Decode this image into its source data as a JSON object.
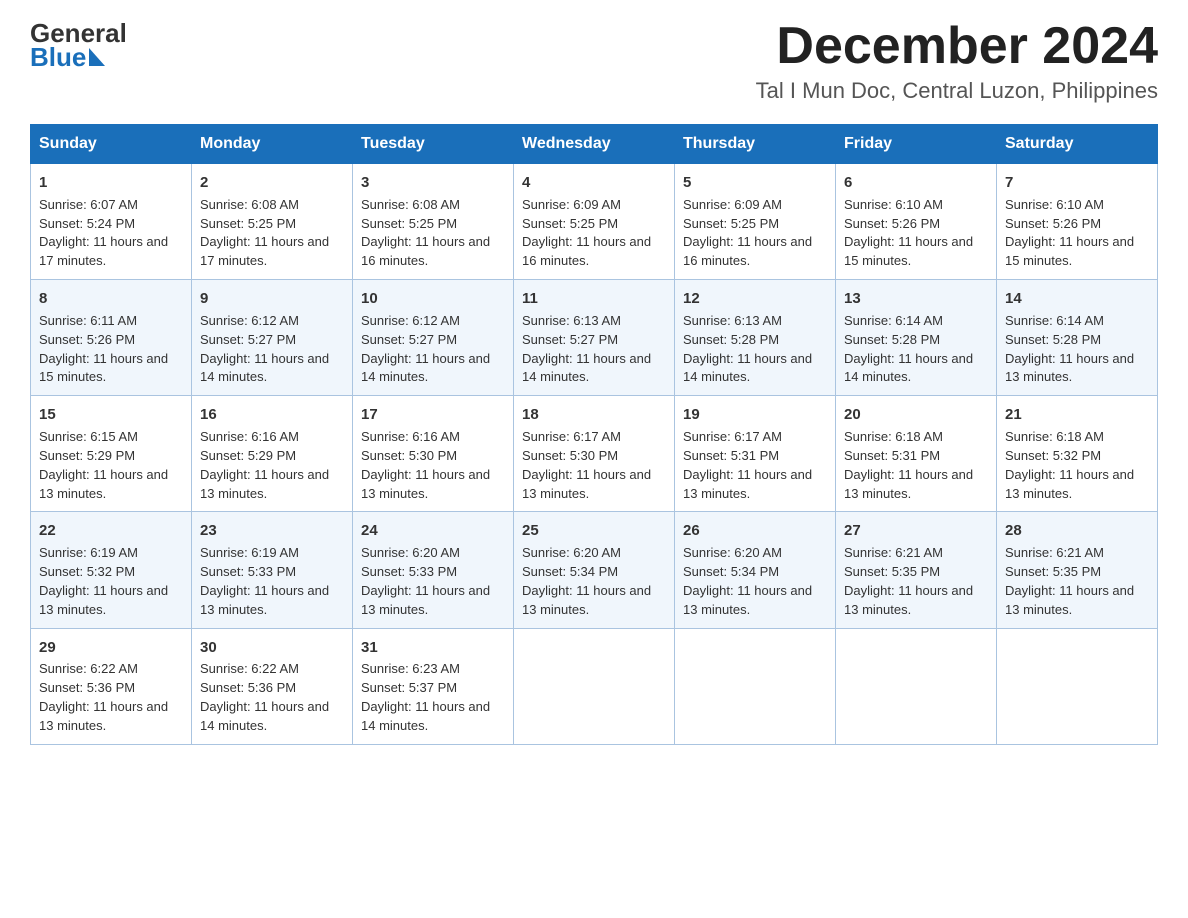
{
  "header": {
    "logo_general": "General",
    "logo_blue": "Blue",
    "month_title": "December 2024",
    "location": "Tal I Mun Doc, Central Luzon, Philippines"
  },
  "days_of_week": [
    "Sunday",
    "Monday",
    "Tuesday",
    "Wednesday",
    "Thursday",
    "Friday",
    "Saturday"
  ],
  "weeks": [
    [
      {
        "day": "1",
        "sunrise": "6:07 AM",
        "sunset": "5:24 PM",
        "daylight": "11 hours and 17 minutes."
      },
      {
        "day": "2",
        "sunrise": "6:08 AM",
        "sunset": "5:25 PM",
        "daylight": "11 hours and 17 minutes."
      },
      {
        "day": "3",
        "sunrise": "6:08 AM",
        "sunset": "5:25 PM",
        "daylight": "11 hours and 16 minutes."
      },
      {
        "day": "4",
        "sunrise": "6:09 AM",
        "sunset": "5:25 PM",
        "daylight": "11 hours and 16 minutes."
      },
      {
        "day": "5",
        "sunrise": "6:09 AM",
        "sunset": "5:25 PM",
        "daylight": "11 hours and 16 minutes."
      },
      {
        "day": "6",
        "sunrise": "6:10 AM",
        "sunset": "5:26 PM",
        "daylight": "11 hours and 15 minutes."
      },
      {
        "day": "7",
        "sunrise": "6:10 AM",
        "sunset": "5:26 PM",
        "daylight": "11 hours and 15 minutes."
      }
    ],
    [
      {
        "day": "8",
        "sunrise": "6:11 AM",
        "sunset": "5:26 PM",
        "daylight": "11 hours and 15 minutes."
      },
      {
        "day": "9",
        "sunrise": "6:12 AM",
        "sunset": "5:27 PM",
        "daylight": "11 hours and 14 minutes."
      },
      {
        "day": "10",
        "sunrise": "6:12 AM",
        "sunset": "5:27 PM",
        "daylight": "11 hours and 14 minutes."
      },
      {
        "day": "11",
        "sunrise": "6:13 AM",
        "sunset": "5:27 PM",
        "daylight": "11 hours and 14 minutes."
      },
      {
        "day": "12",
        "sunrise": "6:13 AM",
        "sunset": "5:28 PM",
        "daylight": "11 hours and 14 minutes."
      },
      {
        "day": "13",
        "sunrise": "6:14 AM",
        "sunset": "5:28 PM",
        "daylight": "11 hours and 14 minutes."
      },
      {
        "day": "14",
        "sunrise": "6:14 AM",
        "sunset": "5:28 PM",
        "daylight": "11 hours and 13 minutes."
      }
    ],
    [
      {
        "day": "15",
        "sunrise": "6:15 AM",
        "sunset": "5:29 PM",
        "daylight": "11 hours and 13 minutes."
      },
      {
        "day": "16",
        "sunrise": "6:16 AM",
        "sunset": "5:29 PM",
        "daylight": "11 hours and 13 minutes."
      },
      {
        "day": "17",
        "sunrise": "6:16 AM",
        "sunset": "5:30 PM",
        "daylight": "11 hours and 13 minutes."
      },
      {
        "day": "18",
        "sunrise": "6:17 AM",
        "sunset": "5:30 PM",
        "daylight": "11 hours and 13 minutes."
      },
      {
        "day": "19",
        "sunrise": "6:17 AM",
        "sunset": "5:31 PM",
        "daylight": "11 hours and 13 minutes."
      },
      {
        "day": "20",
        "sunrise": "6:18 AM",
        "sunset": "5:31 PM",
        "daylight": "11 hours and 13 minutes."
      },
      {
        "day": "21",
        "sunrise": "6:18 AM",
        "sunset": "5:32 PM",
        "daylight": "11 hours and 13 minutes."
      }
    ],
    [
      {
        "day": "22",
        "sunrise": "6:19 AM",
        "sunset": "5:32 PM",
        "daylight": "11 hours and 13 minutes."
      },
      {
        "day": "23",
        "sunrise": "6:19 AM",
        "sunset": "5:33 PM",
        "daylight": "11 hours and 13 minutes."
      },
      {
        "day": "24",
        "sunrise": "6:20 AM",
        "sunset": "5:33 PM",
        "daylight": "11 hours and 13 minutes."
      },
      {
        "day": "25",
        "sunrise": "6:20 AM",
        "sunset": "5:34 PM",
        "daylight": "11 hours and 13 minutes."
      },
      {
        "day": "26",
        "sunrise": "6:20 AM",
        "sunset": "5:34 PM",
        "daylight": "11 hours and 13 minutes."
      },
      {
        "day": "27",
        "sunrise": "6:21 AM",
        "sunset": "5:35 PM",
        "daylight": "11 hours and 13 minutes."
      },
      {
        "day": "28",
        "sunrise": "6:21 AM",
        "sunset": "5:35 PM",
        "daylight": "11 hours and 13 minutes."
      }
    ],
    [
      {
        "day": "29",
        "sunrise": "6:22 AM",
        "sunset": "5:36 PM",
        "daylight": "11 hours and 13 minutes."
      },
      {
        "day": "30",
        "sunrise": "6:22 AM",
        "sunset": "5:36 PM",
        "daylight": "11 hours and 14 minutes."
      },
      {
        "day": "31",
        "sunrise": "6:23 AM",
        "sunset": "5:37 PM",
        "daylight": "11 hours and 14 minutes."
      },
      null,
      null,
      null,
      null
    ]
  ]
}
